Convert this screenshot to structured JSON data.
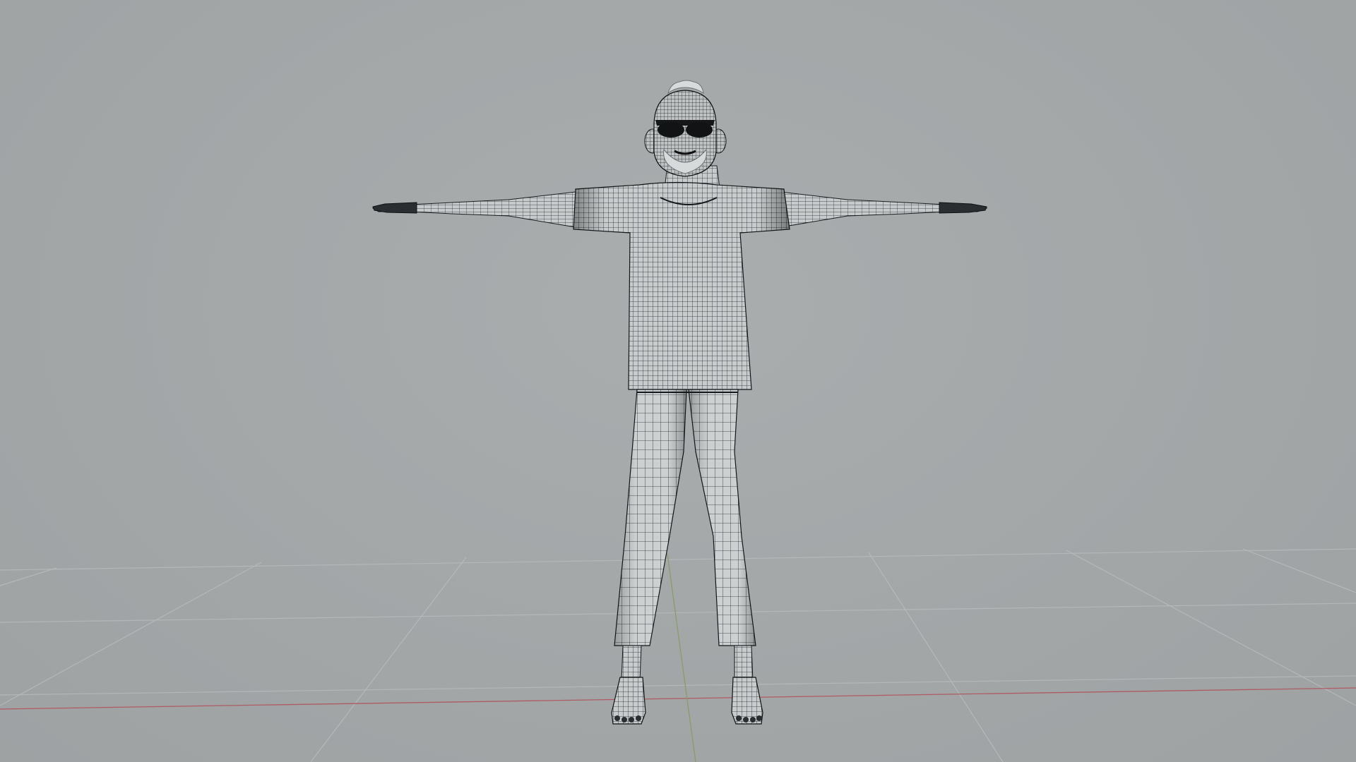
{
  "viewport": {
    "kind": "3d-viewport",
    "view": "front-orthographic",
    "background_color": "#a3a7a8",
    "grid_color": "#b6babb",
    "x_axis_color": "#b05a63",
    "y_axis_color": "#8d9a6a",
    "wire_color": "#1f2224",
    "mesh_base_color": "#c9cccd"
  },
  "model": {
    "name": "t-pose-character-wireframe",
    "pose": "T-pose",
    "display_mode": "wireframe-on-shaded",
    "parts": [
      "head",
      "sunglasses",
      "ears",
      "hair",
      "beard",
      "neck",
      "t-shirt",
      "left-arm",
      "right-arm",
      "left-hand",
      "right-hand",
      "pants-left",
      "pants-right",
      "left-foot",
      "right-foot"
    ]
  }
}
